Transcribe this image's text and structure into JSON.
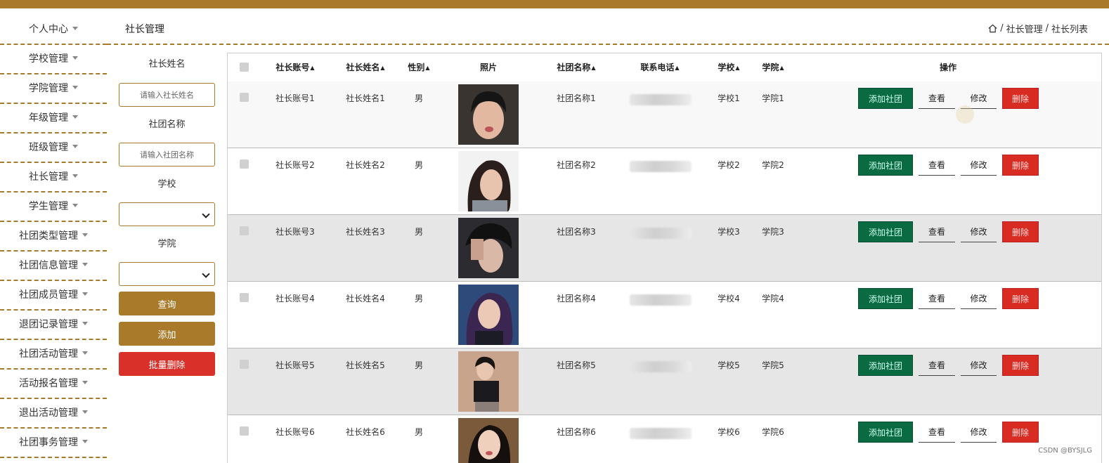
{
  "sidebar": {
    "items": [
      {
        "label": "个人中心"
      },
      {
        "label": "学校管理"
      },
      {
        "label": "学院管理"
      },
      {
        "label": "年级管理"
      },
      {
        "label": "班级管理"
      },
      {
        "label": "社长管理"
      },
      {
        "label": "学生管理"
      },
      {
        "label": "社团类型管理"
      },
      {
        "label": "社团信息管理"
      },
      {
        "label": "社团成员管理"
      },
      {
        "label": "退团记录管理"
      },
      {
        "label": "社团活动管理"
      },
      {
        "label": "活动报名管理"
      },
      {
        "label": "退出活动管理"
      },
      {
        "label": "社团事务管理"
      }
    ]
  },
  "header": {
    "title": "社长管理",
    "breadcrumb": [
      "社长管理",
      "社长列表"
    ],
    "separator": "/"
  },
  "filters": {
    "name_label": "社长姓名",
    "name_placeholder": "请输入社长姓名",
    "club_label": "社团名称",
    "club_placeholder": "请输入社团名称",
    "school_label": "学校",
    "college_label": "学院",
    "query_btn": "查询",
    "add_btn": "添加",
    "batch_delete_btn": "批量删除"
  },
  "table": {
    "columns": {
      "account": "社长账号",
      "name": "社长姓名",
      "gender": "性别",
      "photo": "照片",
      "club": "社团名称",
      "phone": "联系电话",
      "school": "学校",
      "college": "学院",
      "actions": "操作"
    },
    "action_labels": {
      "add_club": "添加社团",
      "view": "查看",
      "edit": "修改",
      "delete": "删除"
    },
    "rows": [
      {
        "account": "社长账号1",
        "name": "社长姓名1",
        "gender": "男",
        "club": "社团名称1",
        "school": "学校1",
        "college": "学院1"
      },
      {
        "account": "社长账号2",
        "name": "社长姓名2",
        "gender": "男",
        "club": "社团名称2",
        "school": "学校2",
        "college": "学院2"
      },
      {
        "account": "社长账号3",
        "name": "社长姓名3",
        "gender": "男",
        "club": "社团名称3",
        "school": "学校3",
        "college": "学院3"
      },
      {
        "account": "社长账号4",
        "name": "社长姓名4",
        "gender": "男",
        "club": "社团名称4",
        "school": "学校4",
        "college": "学院4"
      },
      {
        "account": "社长账号5",
        "name": "社长姓名5",
        "gender": "男",
        "club": "社团名称5",
        "school": "学校5",
        "college": "学院5"
      },
      {
        "account": "社长账号6",
        "name": "社长姓名6",
        "gender": "男",
        "club": "社团名称6",
        "school": "学校6",
        "college": "学院6"
      }
    ]
  },
  "watermark": "CSDN @BYSJLG",
  "colors": {
    "brand": "#a97a2a",
    "add_club": "#0a6b43",
    "delete": "#d82b22",
    "batch_delete": "#d9302a"
  }
}
